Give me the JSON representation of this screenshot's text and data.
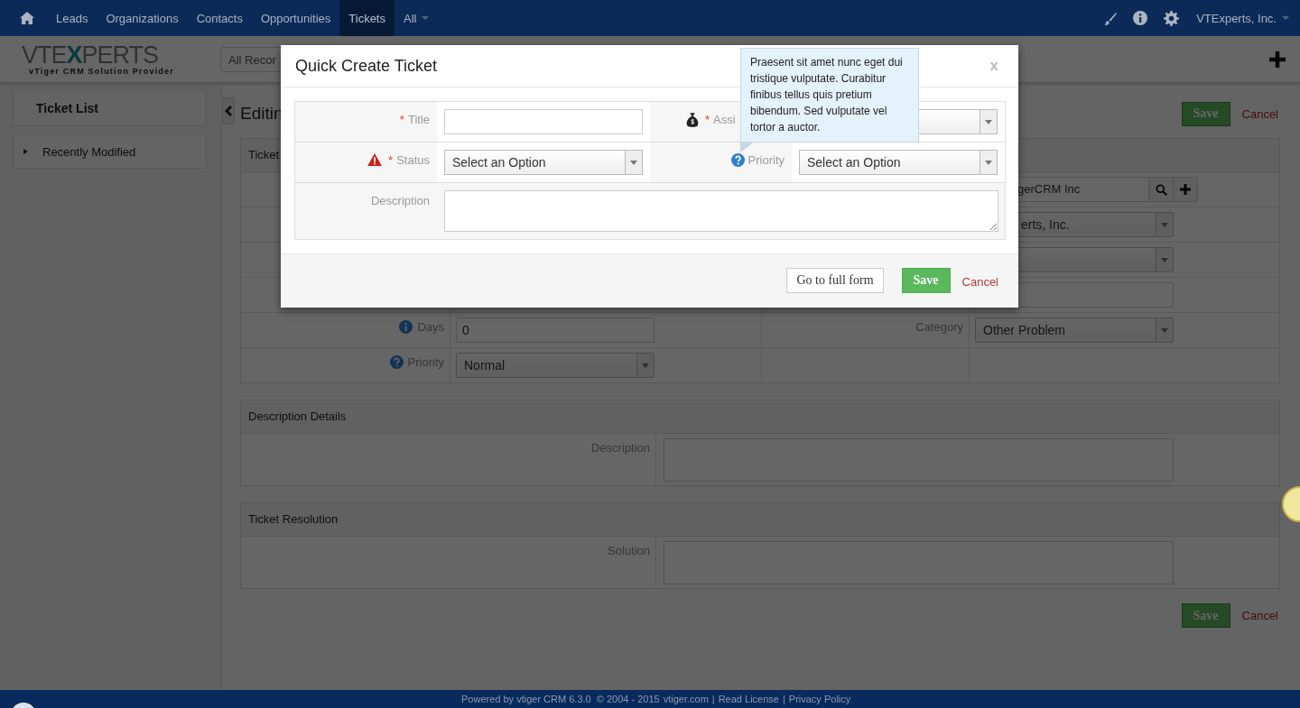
{
  "nav": {
    "items": [
      {
        "label": "Leads",
        "selected": false
      },
      {
        "label": "Organizations",
        "selected": false
      },
      {
        "label": "Contacts",
        "selected": false
      },
      {
        "label": "Opportunities",
        "selected": false
      },
      {
        "label": "Tickets",
        "selected": true
      },
      {
        "label": "All",
        "selected": false,
        "dropdown": true
      }
    ],
    "user": "VTExperts, Inc."
  },
  "header": {
    "logo": {
      "parts": [
        "VTE",
        "X",
        "PERTS"
      ],
      "tagline": "**vTiger** CRM Solution Provider"
    },
    "search": {
      "value": "All Recor"
    }
  },
  "sidebar": {
    "title": "Ticket List",
    "items": [
      {
        "label": "Recently Modified",
        "expanded": false
      }
    ]
  },
  "main": {
    "heading": "Editin",
    "save": "Save",
    "cancel": "Cancel",
    "sections": [
      {
        "title": "Ticket",
        "kind": "grid",
        "rows": [
          {
            "right": {
              "field": {
                "kind": "lookup",
                "value": "gerCRM Inc"
              }
            }
          },
          {
            "right": {
              "field": {
                "kind": "select",
                "value": "erts, Inc."
              }
            }
          },
          {
            "right": {
              "field": {
                "kind": "select"
              }
            }
          },
          {
            "right": {
              "field": {
                "kind": "input"
              }
            }
          },
          {
            "left": {
              "label": "Days",
              "kind": "info",
              "field": {
                "kind": "input",
                "value": "0"
              }
            },
            "right": {
              "label": "Category",
              "field": {
                "kind": "select",
                "value": "Other Problem"
              }
            }
          },
          {
            "left": {
              "label": "Priority",
              "kind": "help",
              "field": {
                "kind": "select",
                "value": "Normal"
              }
            }
          }
        ]
      },
      {
        "title": "Description Details",
        "kind": "wide",
        "rows": [
          {
            "left": {
              "label": "Description",
              "field": {
                "kind": "textarea"
              }
            }
          }
        ]
      },
      {
        "title": "Ticket Resolution",
        "kind": "wide",
        "rows": [
          {
            "left": {
              "label": "Solution",
              "field": {
                "kind": "textarea"
              }
            }
          }
        ]
      }
    ],
    "bottom_save": "Save",
    "bottom_cancel": "Cancel"
  },
  "footer": {
    "text": "Powered by vtiger CRM 6.3.0  © 2004 - 2015",
    "links": [
      {
        "label": "vtiger.com"
      },
      {
        "separator": "|",
        "label": "Read License"
      },
      {
        "separator": "|",
        "label": "Privacy Policy"
      }
    ]
  },
  "modal": {
    "title": "Quick Create Ticket",
    "close": "x",
    "rows": [
      [
        {
          "label": "Title",
          "required_mark": "*",
          "field": {
            "kind": "input"
          }
        },
        {
          "label": "Assi",
          "required_mark": "*",
          "kind": "money",
          "field": {
            "kind": "select"
          }
        }
      ],
      [
        {
          "label": "Status",
          "required_mark": "*",
          "kind": "warning",
          "field": {
            "kind": "select",
            "value": "Select an Option"
          }
        },
        {
          "label": "Priority",
          "kind": "help",
          "field": {
            "kind": "select",
            "value": "Select an Option"
          }
        }
      ],
      [
        {
          "label": "Description",
          "field": {
            "kind": "textarea"
          }
        }
      ]
    ],
    "full_form": "Go to full form",
    "save": "Save",
    "cancel": "Cancel",
    "tooltip": "Praesent sit amet nunc eget dui tristique vulputate. Curabitur finibus tellus quis pretium bibendum. Sed vulputate vel tortor a auctor."
  }
}
